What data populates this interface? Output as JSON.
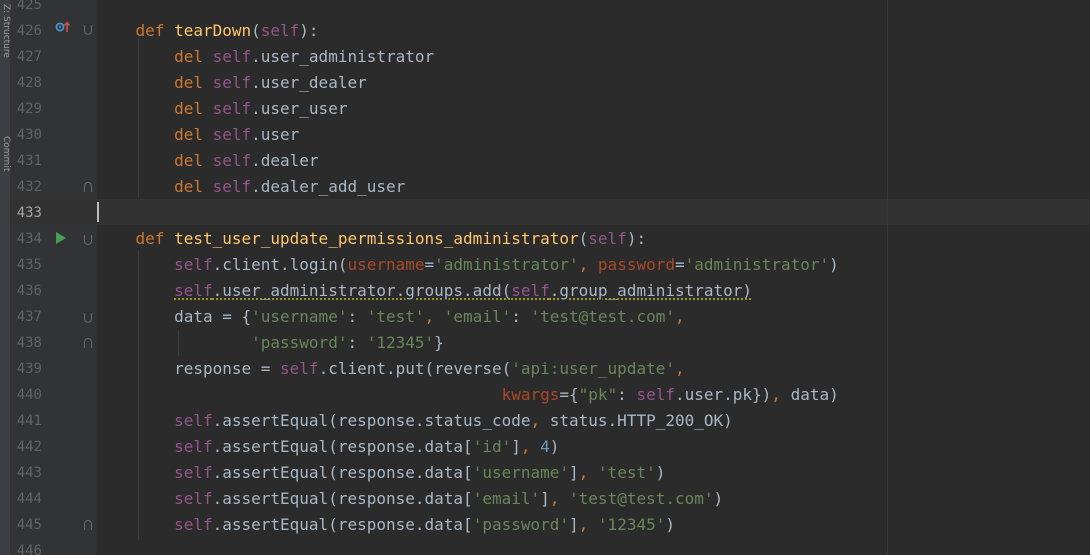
{
  "side_panel": {
    "labels": [
      "Z: Structure",
      "Commit"
    ]
  },
  "editor": {
    "lines": [
      {
        "num": "425",
        "code": []
      },
      {
        "num": "426",
        "code": [
          {
            "t": "    ",
            "c": ""
          },
          {
            "t": "def ",
            "c": "kw"
          },
          {
            "t": "tearDown",
            "c": "fn"
          },
          {
            "t": "(",
            "c": ""
          },
          {
            "t": "self",
            "c": "self"
          },
          {
            "t": "):",
            "c": ""
          }
        ]
      },
      {
        "num": "427",
        "code": [
          {
            "t": "        ",
            "c": ""
          },
          {
            "t": "del ",
            "c": "kw"
          },
          {
            "t": "self",
            "c": "self"
          },
          {
            "t": ".user_administrator",
            "c": ""
          }
        ]
      },
      {
        "num": "428",
        "code": [
          {
            "t": "        ",
            "c": ""
          },
          {
            "t": "del ",
            "c": "kw"
          },
          {
            "t": "self",
            "c": "self"
          },
          {
            "t": ".user_dealer",
            "c": ""
          }
        ]
      },
      {
        "num": "429",
        "code": [
          {
            "t": "        ",
            "c": ""
          },
          {
            "t": "del ",
            "c": "kw"
          },
          {
            "t": "self",
            "c": "self"
          },
          {
            "t": ".user_user",
            "c": ""
          }
        ]
      },
      {
        "num": "430",
        "code": [
          {
            "t": "        ",
            "c": ""
          },
          {
            "t": "del ",
            "c": "kw"
          },
          {
            "t": "self",
            "c": "self"
          },
          {
            "t": ".user",
            "c": ""
          }
        ]
      },
      {
        "num": "431",
        "code": [
          {
            "t": "        ",
            "c": ""
          },
          {
            "t": "del ",
            "c": "kw"
          },
          {
            "t": "self",
            "c": "self"
          },
          {
            "t": ".dealer",
            "c": ""
          }
        ]
      },
      {
        "num": "432",
        "code": [
          {
            "t": "        ",
            "c": ""
          },
          {
            "t": "del ",
            "c": "kw"
          },
          {
            "t": "self",
            "c": "self"
          },
          {
            "t": ".dealer_add_user",
            "c": ""
          }
        ]
      },
      {
        "num": "433",
        "code": [],
        "current": true
      },
      {
        "num": "434",
        "code": [
          {
            "t": "    ",
            "c": ""
          },
          {
            "t": "def ",
            "c": "kw"
          },
          {
            "t": "test_user_update_permissions_administrator",
            "c": "fn"
          },
          {
            "t": "(",
            "c": ""
          },
          {
            "t": "self",
            "c": "self"
          },
          {
            "t": "):",
            "c": ""
          }
        ]
      },
      {
        "num": "435",
        "code": [
          {
            "t": "        ",
            "c": ""
          },
          {
            "t": "self",
            "c": "self"
          },
          {
            "t": ".client.login(",
            "c": ""
          },
          {
            "t": "username",
            "c": "param"
          },
          {
            "t": "=",
            "c": ""
          },
          {
            "t": "'administrator'",
            "c": "str"
          },
          {
            "t": ", ",
            "c": "kw"
          },
          {
            "t": "password",
            "c": "param"
          },
          {
            "t": "=",
            "c": ""
          },
          {
            "t": "'administrator'",
            "c": "str"
          },
          {
            "t": ")",
            "c": ""
          }
        ]
      },
      {
        "num": "436",
        "code": [
          {
            "t": "        ",
            "c": ""
          },
          {
            "t": "self",
            "c": "self warn"
          },
          {
            "t": ".user_administrator.groups.add(",
            "c": "warn"
          },
          {
            "t": "self",
            "c": "self warn"
          },
          {
            "t": ".group_administrator)",
            "c": "warn"
          }
        ]
      },
      {
        "num": "437",
        "code": [
          {
            "t": "        data = {",
            "c": ""
          },
          {
            "t": "'username'",
            "c": "str"
          },
          {
            "t": ": ",
            "c": ""
          },
          {
            "t": "'test'",
            "c": "str"
          },
          {
            "t": ", ",
            "c": "kw"
          },
          {
            "t": "'email'",
            "c": "str"
          },
          {
            "t": ": ",
            "c": ""
          },
          {
            "t": "'test@test.com'",
            "c": "str"
          },
          {
            "t": ",",
            "c": "kw"
          }
        ]
      },
      {
        "num": "438",
        "code": [
          {
            "t": "                ",
            "c": ""
          },
          {
            "t": "'password'",
            "c": "str"
          },
          {
            "t": ": ",
            "c": ""
          },
          {
            "t": "'12345'",
            "c": "str"
          },
          {
            "t": "}",
            "c": ""
          }
        ]
      },
      {
        "num": "439",
        "code": [
          {
            "t": "        response = ",
            "c": ""
          },
          {
            "t": "self",
            "c": "self"
          },
          {
            "t": ".client.put(reverse(",
            "c": ""
          },
          {
            "t": "'api:user_update'",
            "c": "str"
          },
          {
            "t": ",",
            "c": "kw"
          }
        ]
      },
      {
        "num": "440",
        "code": [
          {
            "t": "                                          ",
            "c": ""
          },
          {
            "t": "kwargs",
            "c": "param"
          },
          {
            "t": "={",
            "c": ""
          },
          {
            "t": "\"pk\"",
            "c": "str"
          },
          {
            "t": ": ",
            "c": ""
          },
          {
            "t": "self",
            "c": "self"
          },
          {
            "t": ".user.pk})",
            "c": ""
          },
          {
            "t": ", ",
            "c": "kw"
          },
          {
            "t": "data)",
            "c": ""
          }
        ]
      },
      {
        "num": "441",
        "code": [
          {
            "t": "        ",
            "c": ""
          },
          {
            "t": "self",
            "c": "self"
          },
          {
            "t": ".assertEqual(response.status_code",
            "c": ""
          },
          {
            "t": ", ",
            "c": "kw"
          },
          {
            "t": "status.HTTP_200_OK)",
            "c": ""
          }
        ]
      },
      {
        "num": "442",
        "code": [
          {
            "t": "        ",
            "c": ""
          },
          {
            "t": "self",
            "c": "self"
          },
          {
            "t": ".assertEqual(response.data[",
            "c": ""
          },
          {
            "t": "'id'",
            "c": "str"
          },
          {
            "t": "]",
            "c": ""
          },
          {
            "t": ", ",
            "c": "kw"
          },
          {
            "t": "4",
            "c": "num"
          },
          {
            "t": ")",
            "c": ""
          }
        ]
      },
      {
        "num": "443",
        "code": [
          {
            "t": "        ",
            "c": ""
          },
          {
            "t": "self",
            "c": "self"
          },
          {
            "t": ".assertEqual(response.data[",
            "c": ""
          },
          {
            "t": "'username'",
            "c": "str"
          },
          {
            "t": "]",
            "c": ""
          },
          {
            "t": ", ",
            "c": "kw"
          },
          {
            "t": "'test'",
            "c": "str"
          },
          {
            "t": ")",
            "c": ""
          }
        ]
      },
      {
        "num": "444",
        "code": [
          {
            "t": "        ",
            "c": ""
          },
          {
            "t": "self",
            "c": "self"
          },
          {
            "t": ".assertEqual(response.data[",
            "c": ""
          },
          {
            "t": "'email'",
            "c": "str"
          },
          {
            "t": "]",
            "c": ""
          },
          {
            "t": ", ",
            "c": "kw"
          },
          {
            "t": "'test@test.com'",
            "c": "str"
          },
          {
            "t": ")",
            "c": ""
          }
        ]
      },
      {
        "num": "445",
        "code": [
          {
            "t": "        ",
            "c": ""
          },
          {
            "t": "self",
            "c": "self"
          },
          {
            "t": ".assertEqual(response.data[",
            "c": ""
          },
          {
            "t": "'password'",
            "c": "str"
          },
          {
            "t": "]",
            "c": ""
          },
          {
            "t": ", ",
            "c": "kw"
          },
          {
            "t": "'12345'",
            "c": "str"
          },
          {
            "t": ")",
            "c": ""
          }
        ]
      },
      {
        "num": "446",
        "code": []
      }
    ]
  },
  "colors": {
    "background": "#2b2b2b",
    "gutter": "#313335",
    "keyword": "#cc7832",
    "function": "#ffc66d",
    "self": "#94558d",
    "string": "#6a8759",
    "number": "#6897bb",
    "parameter": "#aa4926",
    "text": "#a9b7c6"
  },
  "icons": {
    "override": "override-up-arrow-icon",
    "run": "run-test-icon",
    "fold": "fold-marker-icon"
  }
}
